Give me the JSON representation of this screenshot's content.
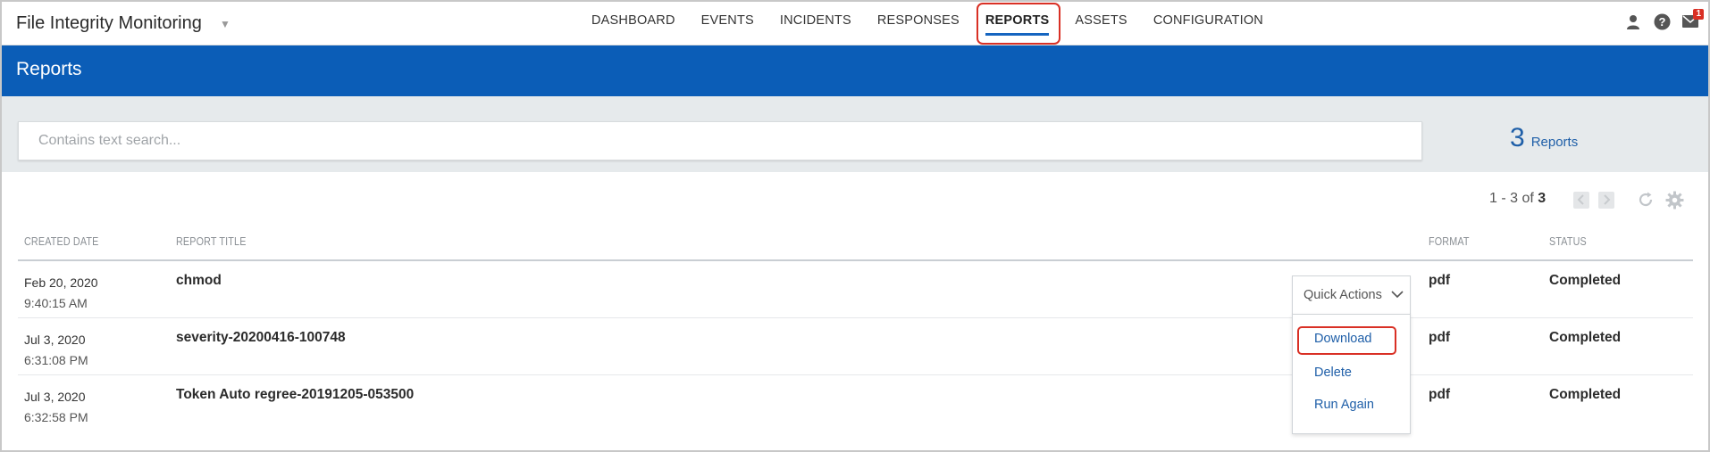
{
  "app": {
    "title": "File Integrity Monitoring"
  },
  "nav": {
    "items": [
      {
        "label": "DASHBOARD"
      },
      {
        "label": "EVENTS"
      },
      {
        "label": "INCIDENTS"
      },
      {
        "label": "RESPONSES"
      },
      {
        "label": "REPORTS",
        "active": true
      },
      {
        "label": "ASSETS"
      },
      {
        "label": "CONFIGURATION"
      }
    ]
  },
  "header_icons": {
    "user": "user-icon",
    "help": "help-icon",
    "mail": "mail-icon",
    "mail_badge": "1"
  },
  "page": {
    "title": "Reports"
  },
  "search": {
    "placeholder": "Contains text search...",
    "value": ""
  },
  "summary": {
    "count": "3",
    "label": "Reports"
  },
  "pagination": {
    "range": "1 - 3 of",
    "total": "3"
  },
  "table": {
    "columns": {
      "created_date": "CREATED DATE",
      "report_title": "REPORT TITLE",
      "format": "FORMAT",
      "status": "STATUS"
    },
    "rows": [
      {
        "date": "Feb 20, 2020",
        "time": "9:40:15 AM",
        "title": "chmod",
        "format": "pdf",
        "status": "Completed"
      },
      {
        "date": "Jul 3, 2020",
        "time": "6:31:08 PM",
        "title": "severity-20200416-100748",
        "format": "pdf",
        "status": "Completed"
      },
      {
        "date": "Jul 3, 2020",
        "time": "6:32:58 PM",
        "title": "Token Auto regree-20191205-053500",
        "format": "pdf",
        "status": "Completed"
      }
    ]
  },
  "quick_actions": {
    "label": "Quick Actions",
    "items": [
      {
        "label": "Download"
      },
      {
        "label": "Delete"
      },
      {
        "label": "Run Again"
      }
    ]
  },
  "colors": {
    "brand_blue": "#0b5db7",
    "link_blue": "#1f5fa8",
    "highlight_red": "#d93025"
  }
}
